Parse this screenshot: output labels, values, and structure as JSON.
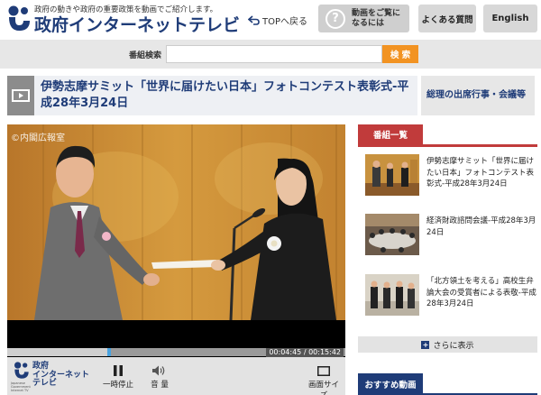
{
  "header": {
    "tagline": "政府の動きや政府の重要政策を動画でご紹介します。",
    "title": "政府インターネットテレビ",
    "top_link": "TOPへ戻る",
    "first_time_label": "動画をご覧に なるには",
    "faq_label": "よくある質問",
    "english_label": "English"
  },
  "search": {
    "label": "番組検索",
    "placeholder": "",
    "button_label": "検 索"
  },
  "program": {
    "title": "伊勢志摩サミット「世界に届けたい日本」フォトコンテスト表彰式-平成28年3月24日"
  },
  "side_heading": "総理の出席行事・会議等",
  "player": {
    "copyright": "©内閣広報室",
    "current_time": "00:04:45",
    "duration": "00:15:42",
    "progress": 0.3,
    "logo_name": "政府\nインターネット\nテレビ",
    "logo_en": "Japanese Government Internet TV",
    "pause_label": "一時停止",
    "volume_label": "音 量",
    "size_label": "画面サイズ"
  },
  "program_list": {
    "tab_label": "番組一覧",
    "items": [
      {
        "title": "伊勢志摩サミット「世界に届けたい日本」フォトコンテスト表彰式-平成28年3月24日"
      },
      {
        "title": "経済財政諮問会議-平成28年3月24日"
      },
      {
        "title": "「北方領土を考える」高校生弁論大会の受賞者による表敬-平成28年3月24日"
      }
    ],
    "more_label": "さらに表示"
  },
  "recommend": {
    "tab_label": "おすすめ動画"
  },
  "colors": {
    "brand_navy": "#1f3c78",
    "accent_orange": "#f29322",
    "list_red": "#c13b3b",
    "seek_blue": "#4aa3df"
  }
}
